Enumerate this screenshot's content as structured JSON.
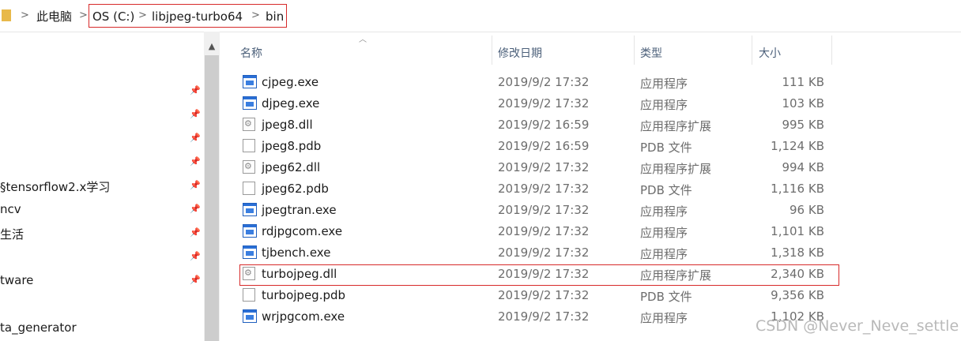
{
  "address_bar": {
    "icon": "folder-icon",
    "crumbs": [
      "此电脑",
      "OS (C:)",
      "libjpeg-turbo64",
      "bin"
    ]
  },
  "nav_pane": {
    "items": [
      "§tensorflow2.x学习",
      "ncv",
      "生活",
      "tware",
      "ta_generator"
    ]
  },
  "file_list": {
    "columns": {
      "name": "名称",
      "date": "修改日期",
      "type": "类型",
      "size": "大小"
    },
    "rows": [
      {
        "name": "cjpeg.exe",
        "date": "2019/9/2 17:32",
        "type": "应用程序",
        "size": "111 KB",
        "icon": "exe-icon"
      },
      {
        "name": "djpeg.exe",
        "date": "2019/9/2 17:32",
        "type": "应用程序",
        "size": "103 KB",
        "icon": "exe-icon"
      },
      {
        "name": "jpeg8.dll",
        "date": "2019/9/2 16:59",
        "type": "应用程序扩展",
        "size": "995 KB",
        "icon": "dll-icon"
      },
      {
        "name": "jpeg8.pdb",
        "date": "2019/9/2 16:59",
        "type": "PDB 文件",
        "size": "1,124 KB",
        "icon": "pdb-file-icon"
      },
      {
        "name": "jpeg62.dll",
        "date": "2019/9/2 17:32",
        "type": "应用程序扩展",
        "size": "994 KB",
        "icon": "dll-icon"
      },
      {
        "name": "jpeg62.pdb",
        "date": "2019/9/2 17:32",
        "type": "PDB 文件",
        "size": "1,116 KB",
        "icon": "pdb-file-icon"
      },
      {
        "name": "jpegtran.exe",
        "date": "2019/9/2 17:32",
        "type": "应用程序",
        "size": "96 KB",
        "icon": "exe-icon"
      },
      {
        "name": "rdjpgcom.exe",
        "date": "2019/9/2 17:32",
        "type": "应用程序",
        "size": "1,101 KB",
        "icon": "exe-icon"
      },
      {
        "name": "tjbench.exe",
        "date": "2019/9/2 17:32",
        "type": "应用程序",
        "size": "1,318 KB",
        "icon": "exe-icon"
      },
      {
        "name": "turbojpeg.dll",
        "date": "2019/9/2 17:32",
        "type": "应用程序扩展",
        "size": "2,340 KB",
        "icon": "dll-icon"
      },
      {
        "name": "turbojpeg.pdb",
        "date": "2019/9/2 17:32",
        "type": "PDB 文件",
        "size": "9,356 KB",
        "icon": "pdb-file-icon"
      },
      {
        "name": "wrjpgcom.exe",
        "date": "2019/9/2 17:32",
        "type": "应用程序",
        "size": "1,102 KB",
        "icon": "exe-icon"
      }
    ]
  },
  "watermark": "CSDN @Never_Neve_settle",
  "colors": {
    "highlight_border": "#d72a2a",
    "header_text": "#4c607a"
  }
}
